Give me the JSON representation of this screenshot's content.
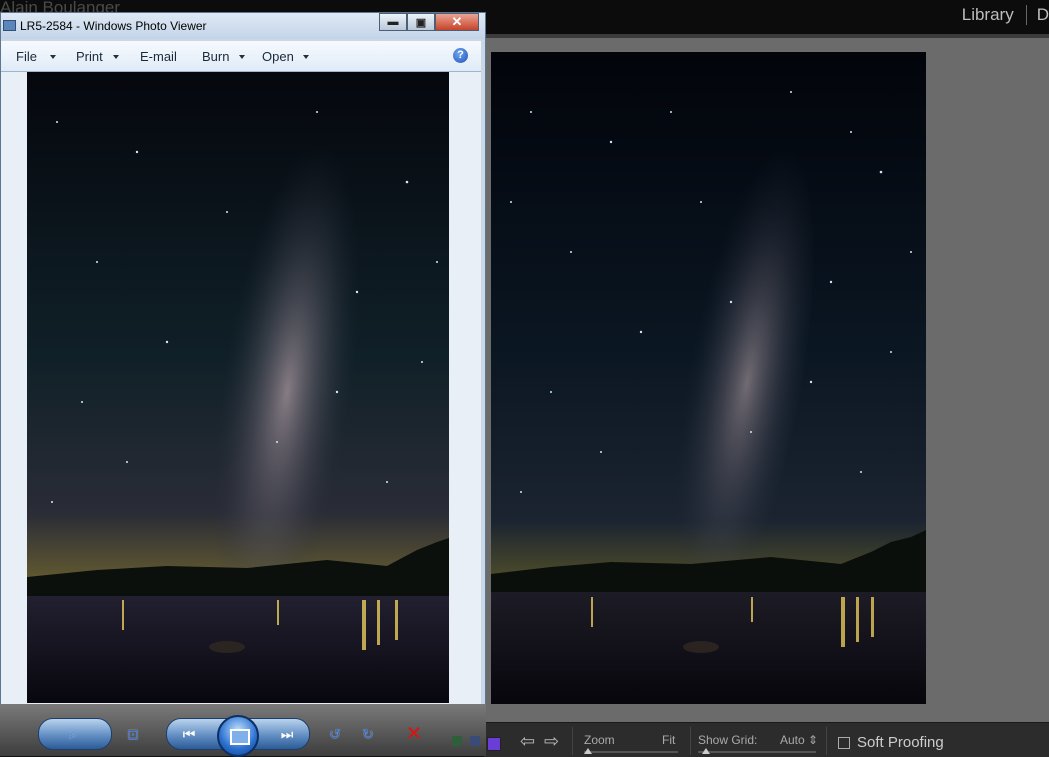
{
  "lightroom": {
    "owner_name": "Alain Boulanger",
    "modules": [
      "Library",
      "D"
    ],
    "toolbar": {
      "zoom_label": "Zoom",
      "zoom_value": "Fit",
      "show_grid_label": "Show Grid:",
      "show_grid_value": "Auto",
      "soft_proofing_label": "Soft Proofing",
      "soft_proofing_checked": false
    }
  },
  "photo_viewer": {
    "title": "LR5-2584 - Windows Photo Viewer",
    "menu": [
      {
        "label": "File",
        "dropdown": true
      },
      {
        "label": "Print",
        "dropdown": true
      },
      {
        "label": "E-mail",
        "dropdown": false
      },
      {
        "label": "Burn",
        "dropdown": true
      },
      {
        "label": "Open",
        "dropdown": true
      }
    ],
    "window_buttons": {
      "minimize": "▬",
      "maximize": "▣",
      "close": "✕"
    },
    "controls": [
      "zoom-icon",
      "actual-size-icon",
      "previous-icon",
      "slideshow-icon",
      "next-icon",
      "rotate-left-icon",
      "rotate-right-icon",
      "delete-icon"
    ]
  },
  "colors": {
    "lr_background": "#6b6b6b",
    "lr_panel": "#2c2c2c",
    "wpv_frame": "#c9d7e6",
    "accent_swatch": "#6a3dd6"
  }
}
